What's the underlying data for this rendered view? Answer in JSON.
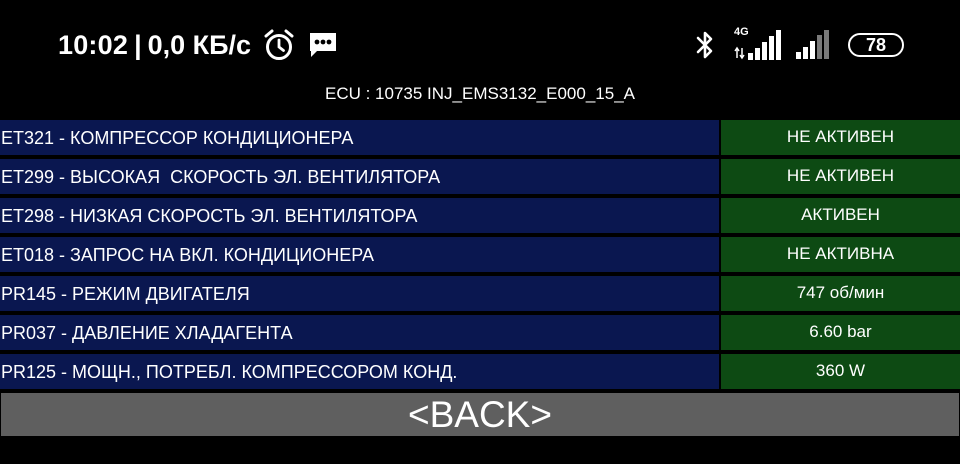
{
  "status_bar": {
    "time": "10:02",
    "separator": "|",
    "network_speed": "0,0 КБ/с",
    "network_type": "4G",
    "battery_level": "78",
    "icons": [
      "alarm-clock-icon",
      "message-icon",
      "bluetooth-icon",
      "signal-icon",
      "signal-icon",
      "battery-icon"
    ]
  },
  "ecu": {
    "text": "ECU : 10735  INJ_EMS3132_E000_15_A"
  },
  "params": [
    {
      "label": "ET321 - КОМПРЕССОР КОНДИЦИОНЕРА",
      "value": "НЕ АКТИВЕН"
    },
    {
      "label": "ET299 - ВЫСОКАЯ  СКОРОСТЬ ЭЛ. ВЕНТИЛЯТОРА",
      "value": "НЕ АКТИВЕН"
    },
    {
      "label": "ET298 - НИЗКАЯ СКОРОСТЬ ЭЛ. ВЕНТИЛЯТОРА",
      "value": "АКТИВЕН"
    },
    {
      "label": "ET018 - ЗАПРОС НА ВКЛ. КОНДИЦИОНЕРА",
      "value": "НЕ АКТИВНА"
    },
    {
      "label": "PR145 - РЕЖИМ ДВИГАТЕЛЯ",
      "value": "747 об/мин"
    },
    {
      "label": "PR037 - ДАВЛЕНИЕ ХЛАДАГЕНТА",
      "value": "6.60 bar"
    },
    {
      "label": "PR125 - МОЩН., ПОТРЕБЛ. КОМПРЕССОРОМ КОНД.",
      "value": "360 W"
    }
  ],
  "back_button": {
    "label": "<BACK>"
  },
  "colors": {
    "background": "#000000",
    "label_bg": "#0a1750",
    "value_bg": "#0d4a13",
    "button_bg": "#5f5f5f",
    "text": "#ffffff"
  }
}
